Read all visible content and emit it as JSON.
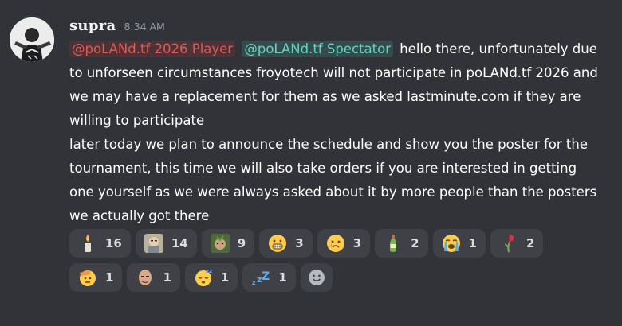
{
  "author": {
    "username": "supra",
    "timestamp": "8:34 AM",
    "avatar_icon": "avatar-person-icon"
  },
  "message": {
    "mentions": [
      {
        "label": "@poLANd.tf 2026 Player",
        "color": "#e35a53"
      },
      {
        "label": "@poLANd.tf Spectator",
        "color": "#62d6bd"
      }
    ],
    "paragraphs": [
      "hello there, unfortunately due to unforseen circumstances froyotech will not participate in poLANd.tf 2026 and we may have a replacement for them as we asked lastminute.com if they are willing to participate",
      "later today we plan to announce the schedule and show you the poster for the tournament, this time we will also take orders if you are interested in getting one yourself as we were always asked about it by more people than the posters we actually got there"
    ]
  },
  "reactions": [
    {
      "icon": "candle-icon",
      "count": "16"
    },
    {
      "icon": "custom-face-photo-icon",
      "count": "14"
    },
    {
      "icon": "custom-frog-photo-icon",
      "count": "9"
    },
    {
      "icon": "grimacing-face-icon",
      "count": "3"
    },
    {
      "icon": "sad-face-icon",
      "count": "3"
    },
    {
      "icon": "bottle-icon",
      "count": "2"
    },
    {
      "icon": "crying-face-icon",
      "count": "1"
    },
    {
      "icon": "wilted-flower-icon",
      "count": "2"
    },
    {
      "icon": "saluting-face-icon",
      "count": "1"
    },
    {
      "icon": "custom-bald-head-icon",
      "count": "1"
    },
    {
      "icon": "sleeping-face-icon",
      "count": "1"
    },
    {
      "icon": "zzz-icon",
      "count": "1"
    }
  ],
  "add_reaction": {
    "icon": "add-reaction-icon"
  }
}
